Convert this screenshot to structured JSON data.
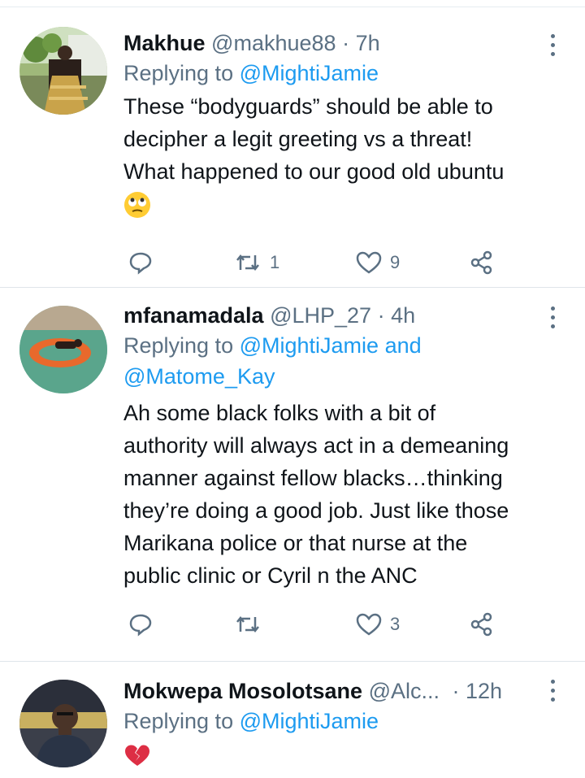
{
  "tweets": [
    {
      "name": "Makhue",
      "handle": "@makhue88",
      "sep": "·",
      "time": "7h",
      "replying_prefix": "Replying to",
      "replying_to": "@MightiJamie",
      "lines": [
        "These “bodyguards” should be able to",
        "decipher a legit greeting vs a threat!",
        "What happened to our good old ubuntu"
      ],
      "emoji": "rolling-eyes-emoji",
      "retweets": "1",
      "likes": "9"
    },
    {
      "name": "mfanamadala",
      "handle": "@LHP_27",
      "sep": "·",
      "time": "4h",
      "replying_prefix": "Replying to",
      "replying_to": "@MightiJamie",
      "replying_and": "and",
      "replying_to_2": "@Matome_Kay",
      "lines": [
        "Ah some black folks with a bit of",
        "authority will always act in a demeaning",
        "manner against fellow blacks…thinking",
        "they’re doing a good job. Just like those",
        "Marikana police or that nurse at the",
        "public clinic or Cyril n the ANC"
      ],
      "retweets": "",
      "likes": "3"
    },
    {
      "name": "Mokwepa Mosolotsane",
      "handle": "@Alc...",
      "sep": "·",
      "time": "12h",
      "replying_prefix": "Replying to",
      "replying_to": "@MightiJamie",
      "emoji": "broken-heart-emoji"
    }
  ],
  "colors": {
    "link": "#1d9bf0",
    "muted": "#5b7083",
    "text": "#0f1419",
    "divider": "#dfe5ea",
    "emoji_face": "#ffcc33",
    "broken_heart": "#dd2e44"
  },
  "icons": [
    "reply-icon",
    "retweet-icon",
    "like-icon",
    "share-icon",
    "more-options-icon"
  ]
}
